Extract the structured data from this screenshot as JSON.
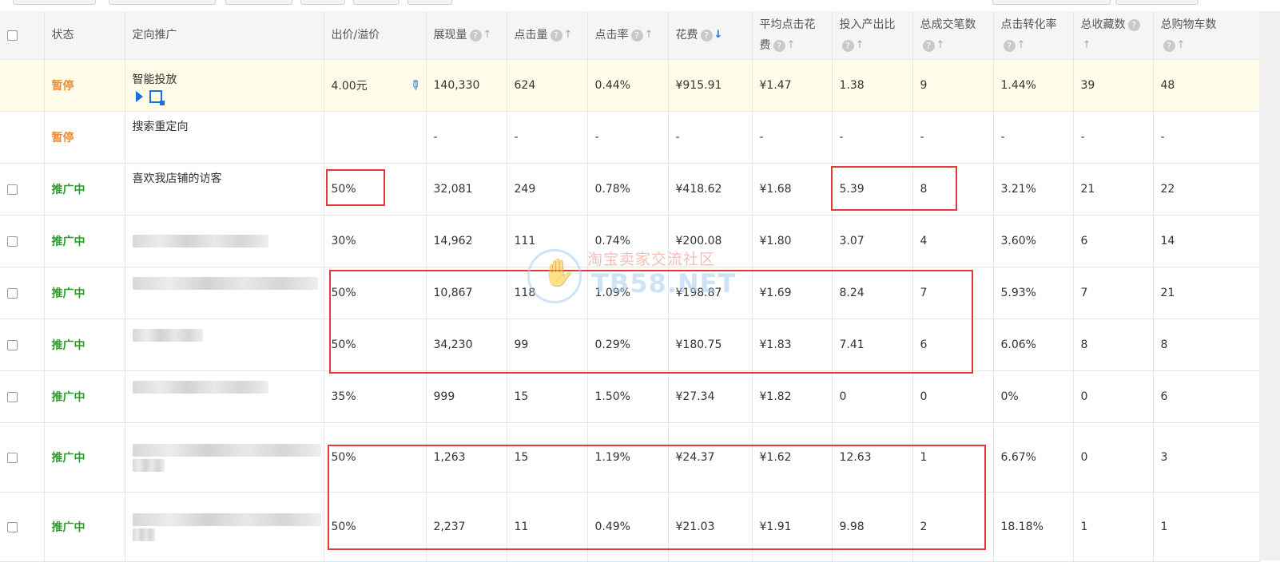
{
  "table": {
    "headers": {
      "status": "状态",
      "target": "定向推广",
      "bid": "出价/溢价",
      "impressions": "展现量",
      "clicks": "点击量",
      "ctr": "点击率",
      "cost": "花费",
      "cpc_line1": "平均点击花",
      "cpc_line2": "费",
      "roi": "投入产出比",
      "orders": "总成交笔数",
      "cvr": "点击转化率",
      "favorites": "总收藏数",
      "cart": "总购物车数"
    },
    "rows": [
      {
        "status": "暂停",
        "name": "智能投放",
        "bid": "4.00元",
        "impressions": "140,330",
        "clicks": "624",
        "ctr": "0.44%",
        "cost": "¥915.91",
        "cpc": "¥1.47",
        "roi": "1.38",
        "orders": "9",
        "cvr": "1.44%",
        "favorites": "39",
        "cart": "48"
      },
      {
        "status": "暂停",
        "name": "搜索重定向",
        "bid": "",
        "impressions": "-",
        "clicks": "-",
        "ctr": "-",
        "cost": "-",
        "cpc": "-",
        "roi": "-",
        "orders": "-",
        "cvr": "-",
        "favorites": "-",
        "cart": "-"
      },
      {
        "status": "推广中",
        "name": "喜欢我店铺的访客",
        "bid": "50%",
        "impressions": "32,081",
        "clicks": "249",
        "ctr": "0.78%",
        "cost": "¥418.62",
        "cpc": "¥1.68",
        "roi": "5.39",
        "orders": "8",
        "cvr": "3.21%",
        "favorites": "21",
        "cart": "22"
      },
      {
        "status": "推广中",
        "name": "",
        "bid": "30%",
        "impressions": "14,962",
        "clicks": "111",
        "ctr": "0.74%",
        "cost": "¥200.08",
        "cpc": "¥1.80",
        "roi": "3.07",
        "orders": "4",
        "cvr": "3.60%",
        "favorites": "6",
        "cart": "14"
      },
      {
        "status": "推广中",
        "name": "",
        "bid": "50%",
        "impressions": "10,867",
        "clicks": "118",
        "ctr": "1.09%",
        "cost": "¥198.87",
        "cpc": "¥1.69",
        "roi": "8.24",
        "orders": "7",
        "cvr": "5.93%",
        "favorites": "7",
        "cart": "21"
      },
      {
        "status": "推广中",
        "name": "",
        "bid": "50%",
        "impressions": "34,230",
        "clicks": "99",
        "ctr": "0.29%",
        "cost": "¥180.75",
        "cpc": "¥1.83",
        "roi": "7.41",
        "orders": "6",
        "cvr": "6.06%",
        "favorites": "8",
        "cart": "8"
      },
      {
        "status": "推广中",
        "name": "",
        "bid": "35%",
        "impressions": "999",
        "clicks": "15",
        "ctr": "1.50%",
        "cost": "¥27.34",
        "cpc": "¥1.82",
        "roi": "0",
        "orders": "0",
        "cvr": "0%",
        "favorites": "0",
        "cart": "6"
      },
      {
        "status": "推广中",
        "name": "",
        "bid": "50%",
        "impressions": "1,263",
        "clicks": "15",
        "ctr": "1.19%",
        "cost": "¥24.37",
        "cpc": "¥1.62",
        "roi": "12.63",
        "orders": "1",
        "cvr": "6.67%",
        "favorites": "0",
        "cart": "3"
      },
      {
        "status": "推广中",
        "name": "",
        "bid": "50%",
        "impressions": "2,237",
        "clicks": "11",
        "ctr": "0.49%",
        "cost": "¥21.03",
        "cpc": "¥1.91",
        "roi": "9.98",
        "orders": "2",
        "cvr": "18.18%",
        "favorites": "1",
        "cart": "1"
      }
    ]
  },
  "watermark": {
    "cn": "淘宝卖家交流社区",
    "en": "TB58.NET"
  },
  "icons": {
    "help": "?",
    "sort_up": "↑",
    "sort_down": "↓",
    "edit": "pencil-icon"
  },
  "colors": {
    "paused": "#f18c2e",
    "active": "#2a9d2a",
    "accent": "#1e6fd9",
    "annotation": "#e03a3a",
    "highlight_row": "#fffde9"
  }
}
